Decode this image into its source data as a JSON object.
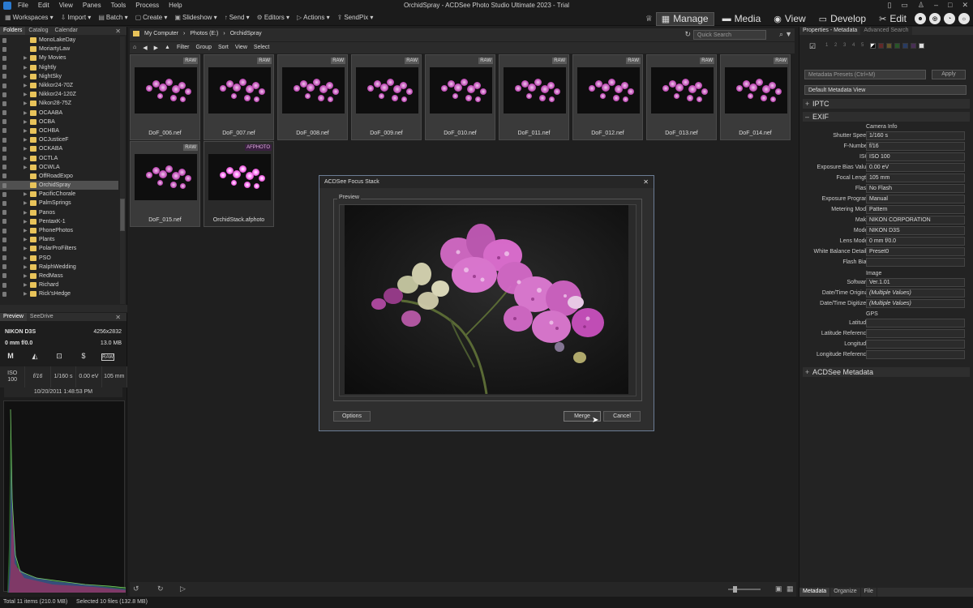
{
  "window": {
    "title": "OrchidSpray - ACDSee Photo Studio Ultimate 2023 - Trial"
  },
  "menu": [
    "File",
    "Edit",
    "View",
    "Panes",
    "Tools",
    "Process",
    "Help"
  ],
  "toolbar": {
    "workspaces": "Workspaces",
    "import": "Import",
    "batch": "Batch",
    "create": "Create",
    "slideshow": "Slideshow",
    "send": "Send",
    "editors": "Editors",
    "actions": "Actions",
    "sendpix": "SendPix"
  },
  "modes": {
    "manage": "Manage",
    "media": "Media",
    "view": "View",
    "develop": "Develop",
    "edit": "Edit"
  },
  "left_tabs": {
    "folders": "Folders",
    "catalog": "Catalog",
    "calendar": "Calendar"
  },
  "folders": [
    "MonoLakeDay",
    "MoriartyLaw",
    "My Movies",
    "Nightly",
    "NightSky",
    "Nikkor24-70Z",
    "Nikkor24-120Z",
    "Nikon28-75Z",
    "OCAABA",
    "OCBA",
    "OCHBA",
    "OCJusticeF",
    "OCKABA",
    "OCTLA",
    "OCWLA",
    "OffRoadExpo",
    "OrchidSpray",
    "PacificChorale",
    "PalmSprings",
    "Panos",
    "PentaxK-1",
    "PhonePhotos",
    "Plants",
    "PolarProFilters",
    "PSO",
    "RalphWedding",
    "RedMass",
    "Richard",
    "Rick'sHedge"
  ],
  "selected_folder": "OrchidSpray",
  "preview_tabs": {
    "preview": "Preview",
    "seedrive": "SeeDrive"
  },
  "camera": {
    "model": "NIKON D3S",
    "dimensions": "4256x2832",
    "lens": "0 mm f/0.0",
    "size": "13.0 MB",
    "mode": "M",
    "format": "RAW",
    "iso_label": "ISO",
    "iso": "100",
    "fnum": "f/16",
    "shutter": "1/160 s",
    "ev": "0.00 eV",
    "focal": "105 mm",
    "date": "10/20/2011 1:48:53 PM"
  },
  "path": {
    "root": "My Computer",
    "drive": "Photos (E:)",
    "folder": "OrchidSpray"
  },
  "search": {
    "placeholder": "Quick Search"
  },
  "filterbar": {
    "filter": "Filter",
    "group": "Group",
    "sort": "Sort",
    "view": "View",
    "select": "Select"
  },
  "thumbnails": [
    {
      "name": "DoF_006.nef",
      "badge": "RAW"
    },
    {
      "name": "DoF_007.nef",
      "badge": "RAW"
    },
    {
      "name": "DoF_008.nef",
      "badge": "RAW"
    },
    {
      "name": "DoF_009.nef",
      "badge": "RAW"
    },
    {
      "name": "DoF_010.nef",
      "badge": "RAW"
    },
    {
      "name": "DoF_011.nef",
      "badge": "RAW"
    },
    {
      "name": "DoF_012.nef",
      "badge": "RAW"
    },
    {
      "name": "DoF_013.nef",
      "badge": "RAW"
    },
    {
      "name": "DoF_014.nef",
      "badge": "RAW"
    },
    {
      "name": "DoF_015.nef",
      "badge": "RAW"
    },
    {
      "name": "OrchidStack.afphoto",
      "badge": "AFPHOTO"
    }
  ],
  "dialog": {
    "title": "ACDSee Focus Stack",
    "preview_label": "Preview",
    "options": "Options",
    "merge": "Merge",
    "cancel": "Cancel"
  },
  "right_tabs": {
    "properties": "Properties - Metadata",
    "advanced": "Advanced Search"
  },
  "metadata": {
    "presets_placeholder": "Metadata Presets (Ctrl+M)",
    "apply": "Apply",
    "view": "Default Metadata View",
    "iptc": "IPTC",
    "exif": "EXIF",
    "camera_info": "Camera Info",
    "image": "Image",
    "gps": "GPS",
    "acdsee": "ACDSee Metadata",
    "swatch_numbers": [
      "1",
      "2",
      "3",
      "4",
      "5"
    ],
    "label_colors": [
      "#c03030",
      "#c0a030",
      "#30a030",
      "#3060c0",
      "#8040a0"
    ],
    "fields": [
      {
        "label": "Shutter Speed",
        "value": "1/160 s"
      },
      {
        "label": "F-Number",
        "value": "f/16"
      },
      {
        "label": "ISO",
        "value": "ISO 100"
      },
      {
        "label": "Exposure Bias Value",
        "value": "0.00 eV"
      },
      {
        "label": "Focal Length",
        "value": "105 mm"
      },
      {
        "label": "Flash",
        "value": "No Flash"
      },
      {
        "label": "Exposure Program",
        "value": "Manual"
      },
      {
        "label": "Metering Mode",
        "value": "Pattern"
      },
      {
        "label": "Make",
        "value": "NIKON CORPORATION"
      },
      {
        "label": "Model",
        "value": "NIKON D3S"
      },
      {
        "label": "Lens Model",
        "value": "0 mm f/0.0"
      },
      {
        "label": "White Balance Details",
        "value": "Preset0"
      },
      {
        "label": "Flash Bias",
        "value": ""
      }
    ],
    "image_fields": [
      {
        "label": "Software",
        "value": "Ver.1.01"
      },
      {
        "label": "Date/Time Original",
        "value": "(Multiple Values)"
      },
      {
        "label": "Date/Time Digitized",
        "value": "(Multiple Values)"
      }
    ],
    "gps_fields": [
      {
        "label": "Latitude",
        "value": ""
      },
      {
        "label": "Latitude Reference",
        "value": ""
      },
      {
        "label": "Longitude",
        "value": ""
      },
      {
        "label": "Longitude Reference",
        "value": ""
      }
    ]
  },
  "bottom_tabs": {
    "metadata": "Metadata",
    "organize": "Organize",
    "file": "File"
  },
  "status": {
    "total": "Total 11 items  (210.0 MB)",
    "selected": "Selected 10 files (132.8 MB)"
  }
}
